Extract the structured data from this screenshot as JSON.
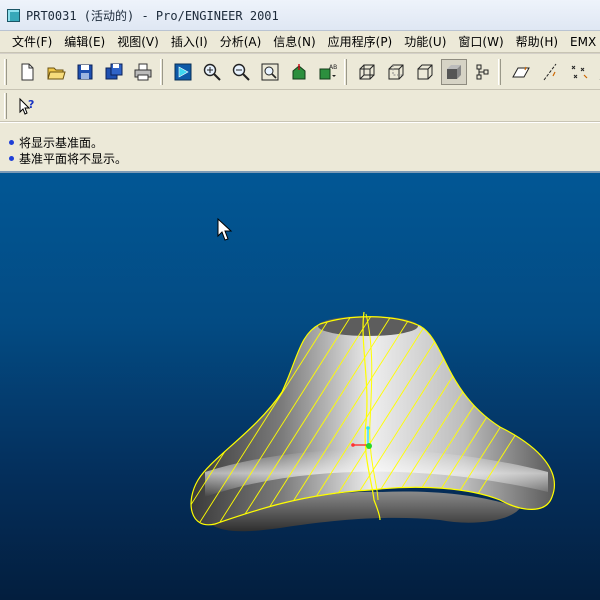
{
  "window": {
    "title": "PRT0031 (活动的) - Pro/ENGINEER 2001"
  },
  "menubar": {
    "items": [
      "文件(F)",
      "编辑(E)",
      "视图(V)",
      "插入(I)",
      "分析(A)",
      "信息(N)",
      "应用程序(P)",
      "功能(U)",
      "窗口(W)",
      "帮助(H)",
      "EMX"
    ]
  },
  "messages": [
    "将显示基准面。",
    "基准平面将不显示。"
  ],
  "colors": {
    "viewport_top": "#025795",
    "viewport_bottom": "#031e3e",
    "selection_highlight": "#ffff00",
    "message_bullet": "#1f3fd7"
  },
  "icons": [
    "new-icon",
    "open-icon",
    "save-icon",
    "save-copy-icon",
    "print-icon",
    "repaint-icon",
    "zoom-in-icon",
    "zoom-out-icon",
    "refit-icon",
    "orient-icon",
    "saved-views-icon",
    "wireframe-icon",
    "hidden-line-icon",
    "no-hidden-icon",
    "shading-icon",
    "model-tree-icon",
    "datum-planes-icon",
    "datum-axes-icon",
    "datum-points-icon",
    "coordinate-systems-icon",
    "context-help-icon"
  ]
}
